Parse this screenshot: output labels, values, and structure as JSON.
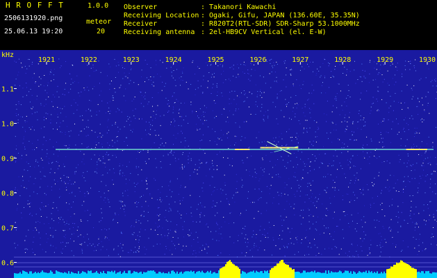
{
  "header": {
    "app_title": "H R O F F T",
    "version": "1.0.0",
    "filename": "2506131920.png",
    "datetime": "25.06.13 19:20",
    "meteor_label": "meteor",
    "meteor_count": "20",
    "fields": [
      {
        "label": "Observer",
        "value": ": Takanori Kawachi"
      },
      {
        "label": "Receiving Location",
        "value": ": Ogaki, Gifu, JAPAN (136.60E, 35.35N)"
      },
      {
        "label": "Receiver",
        "value": ": R820T2(RTL-SDR) SDR-Sharp 53.1000MHz"
      },
      {
        "label": "Receiving antenna",
        "value": ": 2el-HB9CV Vertical (el. E-W)"
      }
    ]
  },
  "colors": {
    "background": "#1a1aa0",
    "header_text": "#ffff00",
    "accent_text": "#33ff33",
    "signal": "#7fffd4",
    "bottom_bars": "#00ccff",
    "bottom_peaks": "#ffff00"
  },
  "chart_data": {
    "type": "heatmap",
    "ylabel": "kHz",
    "x_ticks": [
      "1921",
      "1922",
      "1923",
      "1924",
      "1925",
      "1926",
      "1927",
      "1928",
      "1929",
      "1930"
    ],
    "y_ticks": [
      "1.1",
      "1.0",
      "0.9",
      "0.8",
      "0.7",
      "0.6"
    ],
    "ylim": [
      0.575,
      1.175
    ],
    "carrier_khz": 0.925,
    "meteor_echoes": [
      {
        "x_start_min": 1925.45,
        "x_end_min": 1925.8,
        "khz": 0.925
      },
      {
        "x_start_min": 1926.05,
        "x_end_min": 1926.95,
        "khz": 0.93
      },
      {
        "x_start_min": 1929.5,
        "x_end_min": 1930.0,
        "khz": 0.925
      }
    ]
  }
}
